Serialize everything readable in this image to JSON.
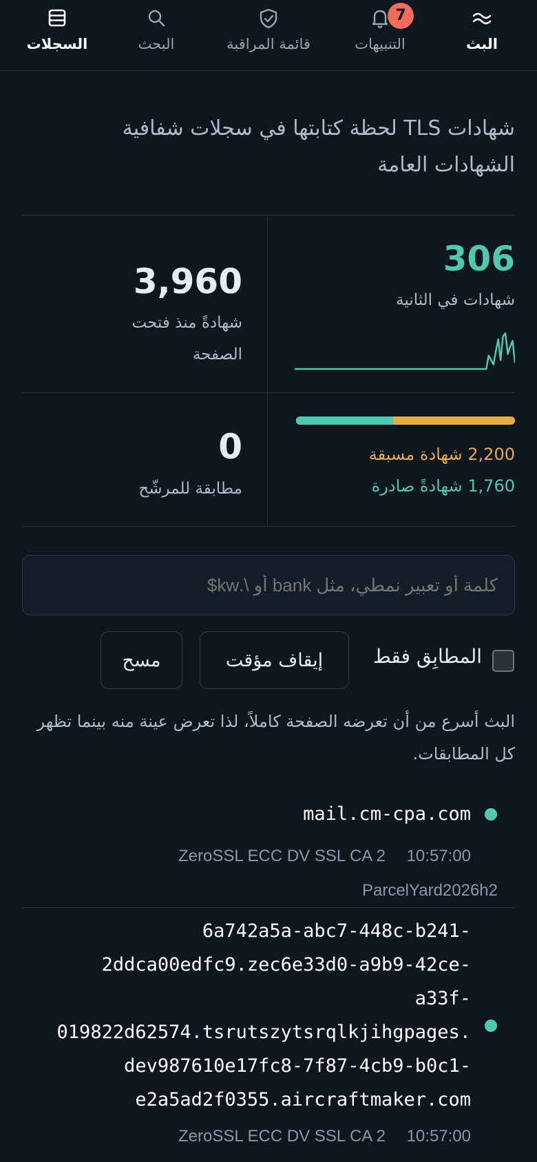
{
  "nav": {
    "items": [
      {
        "key": "stream",
        "label": "البث",
        "icon": "waves-icon",
        "active": true
      },
      {
        "key": "alerts",
        "label": "التنبيهات",
        "icon": "bell-icon",
        "badge": "7"
      },
      {
        "key": "watchlist",
        "label": "قائمة المراقبة",
        "icon": "shield-check-icon"
      },
      {
        "key": "search",
        "label": "البحث",
        "icon": "search-icon"
      },
      {
        "key": "logs",
        "label": "السجلات",
        "icon": "database-icon",
        "active": true
      }
    ]
  },
  "headline": "شهادات TLS لحظة كتابتها في سجلات شفافية الشهادات العامة",
  "stats": {
    "rate_value": "306",
    "rate_label": "شهادات في الثانية",
    "total_value": "3,960",
    "total_label": "شهادةً منذ فتحت الصفحة",
    "matches_value": "0",
    "matches_label": "مطابقة للمرشّح",
    "precert_line": "2,200 شهادة مسبقة",
    "issued_line": "1,760 شهادةً صادرة",
    "issued_count": 1760,
    "precert_count": 2200,
    "sparkline": [
      0,
      0,
      0,
      0,
      0,
      0,
      0,
      0,
      0,
      0,
      0,
      0,
      0,
      0,
      0,
      0,
      0,
      0,
      0,
      0,
      0,
      0,
      0,
      0,
      0,
      0,
      0,
      0,
      0,
      0,
      0,
      0,
      0,
      0,
      0,
      0,
      0,
      0,
      0,
      0,
      0,
      0,
      0,
      0,
      0,
      0,
      0,
      0,
      0,
      0,
      0,
      0,
      0,
      0,
      0,
      0,
      0,
      0,
      0,
      0,
      0,
      0,
      0,
      0,
      0,
      0,
      0,
      0,
      0,
      0,
      0,
      0,
      0,
      0,
      0,
      0,
      0,
      0,
      0,
      0,
      0,
      18,
      12,
      6,
      24,
      40,
      12,
      44,
      48,
      20,
      30,
      38,
      8
    ],
    "colors": {
      "teal": "#4ec9b0",
      "orange": "#e6ad49"
    }
  },
  "filter": {
    "placeholder": "كلمة أو تعبير نمطي، مثل bank أو \\.kw$",
    "matched_only_label": "المطابِق فقط",
    "pause_label": "إيقاف مؤقت",
    "clear_label": "مسح"
  },
  "note": "البث أسرع من أن تعرضه الصفحة كاملاً، لذا تعرض عينة منه بينما تظهر كل المطابقات.",
  "feed": [
    {
      "domain": "mail.cm-cpa.com",
      "time": "10:57:00",
      "issuer": "ZeroSSL ECC DV SSL CA 2",
      "log": "ParcelYard2026h2"
    },
    {
      "domain": "6a742a5a-abc7-448c-b241-\n2ddca00edfc9.zec6e33d0-a9b9-42ce-\na33f-\n019822d62574.tsrutszytsrqlkjihgpages.\ndev987610e17fc8-7f87-4cb9-b0c1-\ne2a5ad2f0355.aircraftmaker.com",
      "time": "10:57:00",
      "issuer": "ZeroSSL ECC DV SSL CA 2"
    }
  ]
}
